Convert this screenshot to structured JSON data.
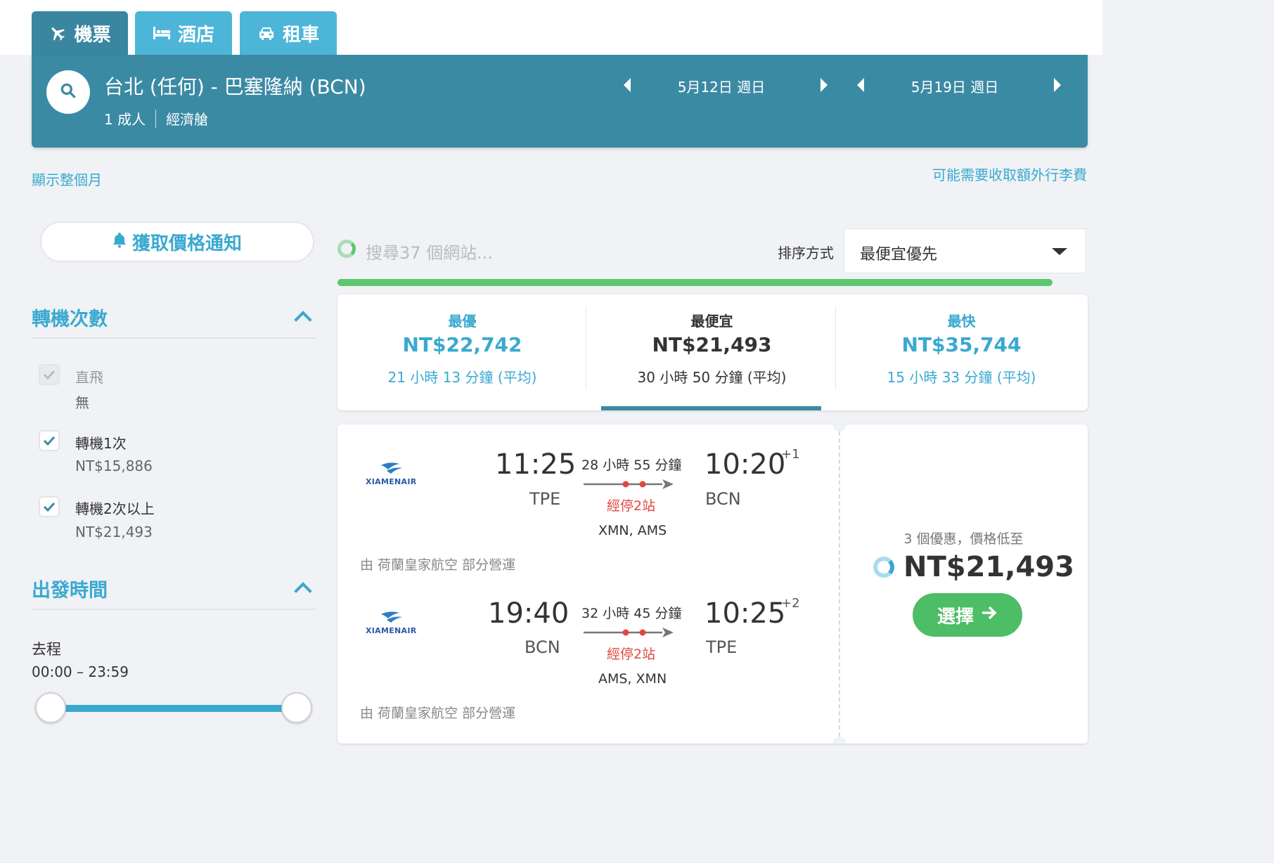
{
  "tabs": [
    {
      "label": "機票",
      "icon": "plane-icon"
    },
    {
      "label": "酒店",
      "icon": "bed-icon"
    },
    {
      "label": "租車",
      "icon": "car-icon"
    }
  ],
  "search": {
    "route": "台北 (任何) - 巴塞隆納 (BCN)",
    "passengers": "1 成人",
    "cabin": "經濟艙",
    "depart_date": "5月12日 週日",
    "return_date": "5月19日 週日"
  },
  "links": {
    "show_month": "顯示整個月",
    "baggage_fee": "可能需要收取額外行李費"
  },
  "price_alert_label": "獲取價格通知",
  "filters": {
    "stops_title": "轉機次數",
    "stops": [
      {
        "label": "直飛",
        "price": "無",
        "checked": true,
        "disabled": true
      },
      {
        "label": "轉機1次",
        "price": "NT$15,886",
        "checked": true,
        "disabled": false
      },
      {
        "label": "轉機2次以上",
        "price": "NT$21,493",
        "checked": true,
        "disabled": false
      }
    ],
    "departure_title": "出發時間",
    "outbound_label": "去程",
    "outbound_range": "00:00 – 23:59"
  },
  "results": {
    "status": "搜尋37 個網站...",
    "sort_label": "排序方式",
    "sort_value": "最便宜優先",
    "progress": 1.0
  },
  "summary": [
    {
      "label": "最優",
      "price": "NT$22,742",
      "duration": "21 小時 13 分鐘 (平均)"
    },
    {
      "label": "最便宜",
      "price": "NT$21,493",
      "duration": "30 小時 50 分鐘 (平均)"
    },
    {
      "label": "最快",
      "price": "NT$35,744",
      "duration": "15 小時 33 分鐘 (平均)"
    }
  ],
  "summary_selected": "最便宜",
  "result_card": {
    "legs": [
      {
        "airline": "XIAMENAIR",
        "dep_time": "11:25",
        "dep_code": "TPE",
        "arr_time": "10:20",
        "arr_code": "BCN",
        "day_offset": "+1",
        "duration": "28 小時 55 分鐘",
        "stops": "經停2站",
        "via": "XMN, AMS",
        "operated_by": "由 荷蘭皇家航空 部分營運"
      },
      {
        "airline": "XIAMENAIR",
        "dep_time": "19:40",
        "dep_code": "BCN",
        "arr_time": "10:25",
        "arr_code": "TPE",
        "day_offset": "+2",
        "duration": "32 小時 45 分鐘",
        "stops": "經停2站",
        "via": "AMS, XMN",
        "operated_by": "由 荷蘭皇家航空 部分營運"
      }
    ],
    "offers": "3 個優惠，價格低至",
    "price": "NT$21,493",
    "select_label": "選擇"
  },
  "colors": {
    "accent": "#3aa9d0",
    "header": "#3b8aa4",
    "tab_active": "#3a86a0",
    "tab": "#4db6d8",
    "green": "#4dbd66",
    "stops_red": "#e2473d"
  }
}
